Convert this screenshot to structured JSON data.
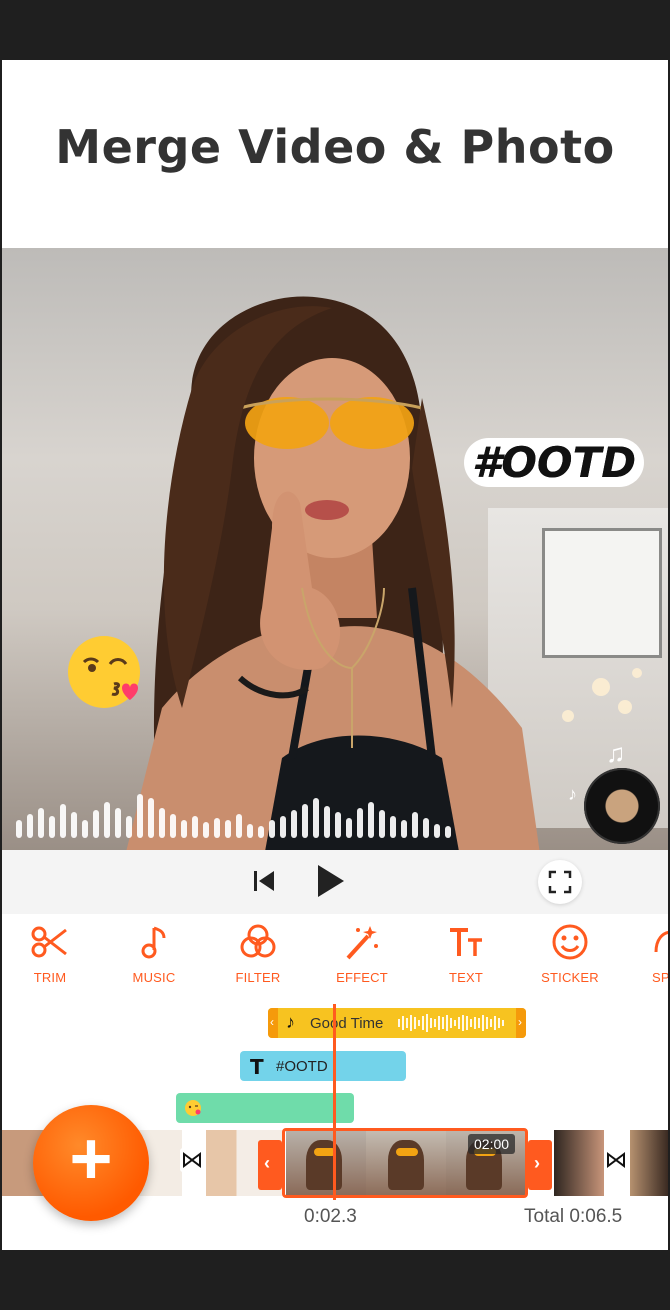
{
  "headline": "Merge Video & Photo",
  "preview": {
    "text_sticker": "#OOTD",
    "emoji_sticker_icon": "kissing-face-emoji",
    "music_disc_icon": "music-disc-icon"
  },
  "playback": {
    "prev_icon": "skip-previous-icon",
    "play_icon": "play-icon",
    "fullscreen_icon": "fullscreen-icon"
  },
  "tools": [
    {
      "label": "TRIM",
      "icon": "scissors-icon"
    },
    {
      "label": "MUSIC",
      "icon": "music-note-icon"
    },
    {
      "label": "FILTER",
      "icon": "filter-circles-icon"
    },
    {
      "label": "EFFECT",
      "icon": "magic-wand-icon"
    },
    {
      "label": "TEXT",
      "icon": "text-icon"
    },
    {
      "label": "STICKER",
      "icon": "smiley-icon"
    },
    {
      "label": "SP",
      "icon": "speed-icon"
    }
  ],
  "timeline": {
    "music_track_label": "Good Time",
    "text_track_label": "#OOTD",
    "clip_duration": "02:00",
    "current_time": "0:02.3",
    "total_time": "Total 0:06.5"
  },
  "colors": {
    "accent": "#ff5a1f",
    "music_track": "#f7c320",
    "text_track": "#73d3ea",
    "emoji_track": "#6fdcaa"
  }
}
